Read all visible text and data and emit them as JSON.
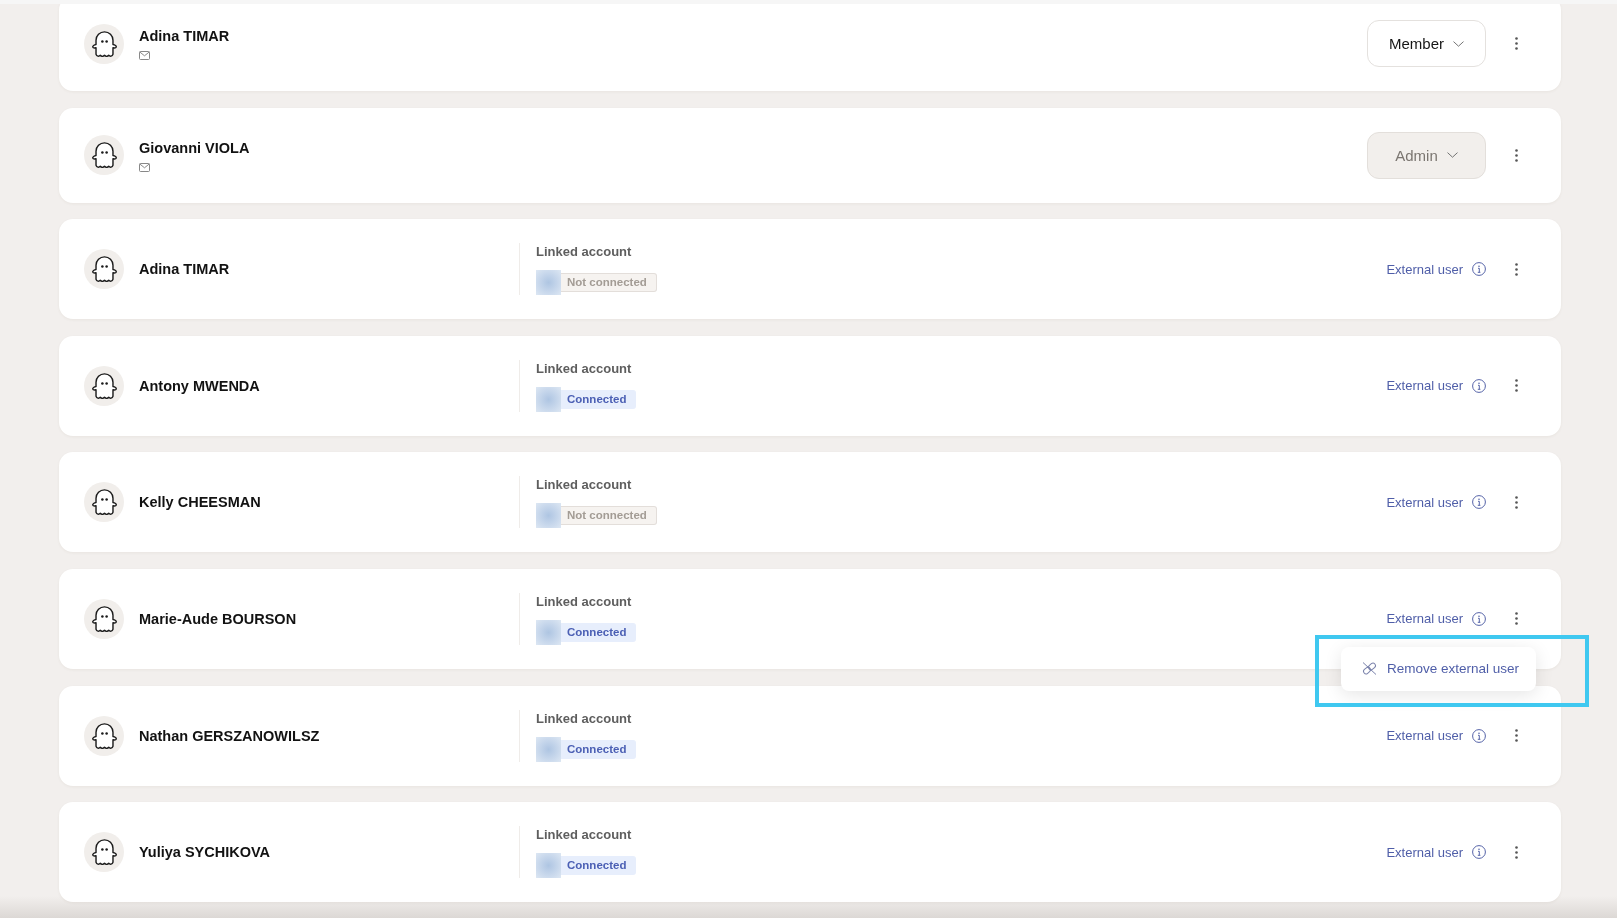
{
  "users": [
    {
      "kind": "member",
      "name": "Adina TIMAR",
      "role": {
        "label": "Member",
        "disabled": false
      }
    },
    {
      "kind": "member",
      "name": "Giovanni VIOLA",
      "role": {
        "label": "Admin",
        "disabled": true
      }
    },
    {
      "kind": "external",
      "name": "Adina TIMAR",
      "linked_account": {
        "label": "Linked account",
        "status": "Not connected",
        "connected": false
      },
      "user_type": "External user"
    },
    {
      "kind": "external",
      "name": "Antony MWENDA",
      "linked_account": {
        "label": "Linked account",
        "status": "Connected",
        "connected": true
      },
      "user_type": "External user"
    },
    {
      "kind": "external",
      "name": "Kelly CHEESMAN",
      "linked_account": {
        "label": "Linked account",
        "status": "Not connected",
        "connected": false
      },
      "user_type": "External user"
    },
    {
      "kind": "external",
      "name": "Marie-Aude BOURSON",
      "linked_account": {
        "label": "Linked account",
        "status": "Connected",
        "connected": true
      },
      "user_type": "External user",
      "menu": {
        "highlighted": true,
        "items": [
          {
            "label": "Remove external user"
          }
        ]
      }
    },
    {
      "kind": "external",
      "name": "Nathan GERSZANOWILSZ",
      "linked_account": {
        "label": "Linked account",
        "status": "Connected",
        "connected": true
      },
      "user_type": "External user"
    },
    {
      "kind": "external",
      "name": "Yuliya SYCHIKOVA",
      "linked_account": {
        "label": "Linked account",
        "status": "Connected",
        "connected": true
      },
      "user_type": "External user"
    }
  ]
}
